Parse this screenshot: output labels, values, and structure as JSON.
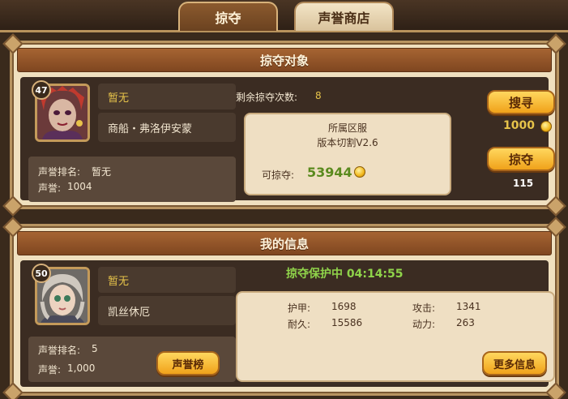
{
  "tabs": [
    {
      "label": "掠夺",
      "active": true
    },
    {
      "label": "声誉商店",
      "active": false
    }
  ],
  "target_panel": {
    "title": "掠夺对象",
    "avatar": {
      "level": "47",
      "icon": "red-haired-villain-portrait"
    },
    "status": "暂无",
    "name": "商船・弗洛伊安蒙",
    "rank_label": "声誉排名:",
    "rank_value": "暂无",
    "reputation_label": "声誉:",
    "reputation_value": "1004",
    "remaining_label": "剩余掠夺次数:",
    "remaining_value": "8",
    "server_line1": "所属区服",
    "server_line2": "版本切割V2.6",
    "lootable_label": "可掠夺:",
    "lootable_value": "53944",
    "search_button": "搜寻",
    "search_cost": "1000",
    "plunder_button": "掠夺",
    "plunder_cost": "115"
  },
  "my_panel": {
    "title": "我的信息",
    "avatar": {
      "level": "50",
      "icon": "silver-haired-heroine-portrait"
    },
    "status": "暂无",
    "name": "凯丝休厄",
    "rank_label": "声誉排名:",
    "rank_value": "5",
    "reputation_label": "声誉:",
    "reputation_value": "1,000",
    "leaderboard_button": "声誉榜",
    "protection_text": "掠夺保护中 04:14:55",
    "stats": {
      "armor_label": "护甲:",
      "armor_value": "1698",
      "attack_label": "攻击:",
      "attack_value": "1341",
      "durability_label": "耐久:",
      "durability_value": "15586",
      "power_label": "动力:",
      "power_value": "263"
    },
    "more_info_button": "更多信息"
  },
  "colors": {
    "accent_yellow": "#e6c34a",
    "protection_green": "#8fd34a",
    "button_orange": "#f0a21a"
  }
}
